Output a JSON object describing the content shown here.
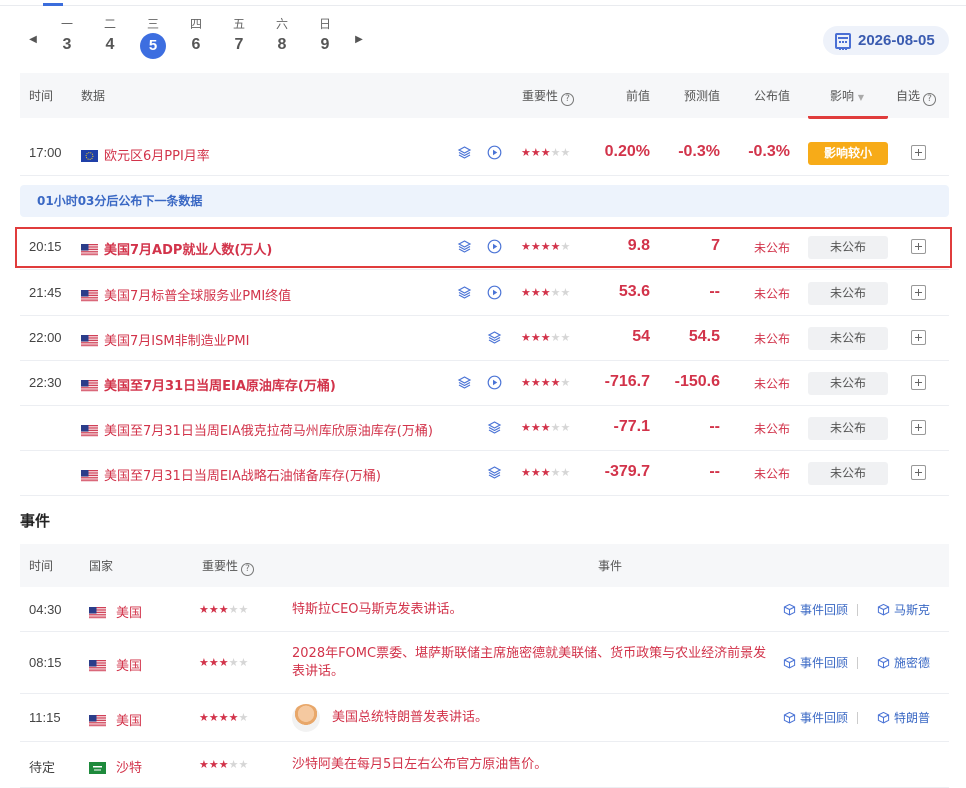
{
  "date_bar": {
    "days": [
      {
        "weekday": "一",
        "day": "3"
      },
      {
        "weekday": "二",
        "day": "4"
      },
      {
        "weekday": "三",
        "day": "5",
        "active": true
      },
      {
        "weekday": "四",
        "day": "6"
      },
      {
        "weekday": "五",
        "day": "7"
      },
      {
        "weekday": "六",
        "day": "8"
      },
      {
        "weekday": "日",
        "day": "9"
      }
    ],
    "prev_icon": "triangle-left-icon",
    "next_icon": "triangle-right-icon",
    "selected_date": "2026-08-05"
  },
  "data_table": {
    "headers": {
      "time": "时间",
      "data": "数据",
      "importance": "重要性",
      "previous": "前值",
      "forecast": "预测值",
      "actual": "公布值",
      "impact": "影响",
      "watch": "自选"
    },
    "rows": [
      {
        "time": "17:00",
        "flag": "eu",
        "name": "欧元区6月PPI月率",
        "bold": false,
        "video": true,
        "stars": 3,
        "previous": "0.20%",
        "forecast": "-0.3%",
        "actual": "-0.3%",
        "status": "影响较小",
        "status_style": "orange"
      },
      {
        "time": "20:15",
        "flag": "us",
        "name": "美国7月ADP就业人数(万人)",
        "bold": true,
        "video": true,
        "stars": 4,
        "previous": "9.8",
        "forecast": "7",
        "actual": "未公布",
        "status": "未公布",
        "status_style": "gray"
      },
      {
        "time": "21:45",
        "flag": "us",
        "name": "美国7月标普全球服务业PMI终值",
        "bold": false,
        "video": true,
        "stars": 3,
        "previous": "53.6",
        "forecast": "--",
        "actual": "未公布",
        "status": "未公布",
        "status_style": "gray"
      },
      {
        "time": "22:00",
        "flag": "us",
        "name": "美国7月ISM非制造业PMI",
        "bold": false,
        "video": false,
        "stars": 3,
        "previous": "54",
        "forecast": "54.5",
        "actual": "未公布",
        "status": "未公布",
        "status_style": "gray"
      },
      {
        "time": "22:30",
        "flag": "us",
        "name": "美国至7月31日当周EIA原油库存(万桶)",
        "bold": true,
        "video": true,
        "stars": 4,
        "previous": "-716.7",
        "forecast": "-150.6",
        "actual": "未公布",
        "status": "未公布",
        "status_style": "gray"
      },
      {
        "time": "",
        "flag": "us",
        "name": "美国至7月31日当周EIA俄克拉荷马州库欣原油库存(万桶)",
        "bold": false,
        "video": false,
        "stars": 3,
        "previous": "-77.1",
        "forecast": "--",
        "actual": "未公布",
        "status": "未公布",
        "status_style": "gray"
      },
      {
        "time": "",
        "flag": "us",
        "name": "美国至7月31日当周EIA战略石油储备库存(万桶)",
        "bold": false,
        "video": false,
        "stars": 3,
        "previous": "-379.7",
        "forecast": "--",
        "actual": "未公布",
        "status": "未公布",
        "status_style": "gray"
      }
    ],
    "notice": "01小时03分后公布下一条数据"
  },
  "events": {
    "title": "事件",
    "headers": {
      "time": "时间",
      "country": "国家",
      "importance": "重要性",
      "event": "事件"
    },
    "rows": [
      {
        "time": "04:30",
        "flag": "us",
        "country": "美国",
        "stars": 3,
        "event": "特斯拉CEO马斯克发表讲话。",
        "avatar": false,
        "link1": "事件回顾",
        "link2": "马斯克"
      },
      {
        "time": "08:15",
        "flag": "us",
        "country": "美国",
        "stars": 3,
        "event": "2028年FOMC票委、堪萨斯联储主席施密德就美联储、货币政策与农业经济前景发表讲话。",
        "avatar": false,
        "link1": "事件回顾",
        "link2": "施密德"
      },
      {
        "time": "11:15",
        "flag": "us",
        "country": "美国",
        "stars": 4,
        "event": "美国总统特朗普发表讲话。",
        "avatar": true,
        "link1": "事件回顾",
        "link2": "特朗普"
      },
      {
        "time": "待定",
        "flag": "sa",
        "country": "沙特",
        "stars": 3,
        "event": "沙特阿美在每月5日左右公布官方原油售价。",
        "avatar": false,
        "link1": "",
        "link2": ""
      }
    ]
  },
  "colors": {
    "accent": "#3d6ee0",
    "positive_red": "#d2334a",
    "impact_orange": "#f7ab18",
    "highlight_border": "#e03c3c"
  }
}
